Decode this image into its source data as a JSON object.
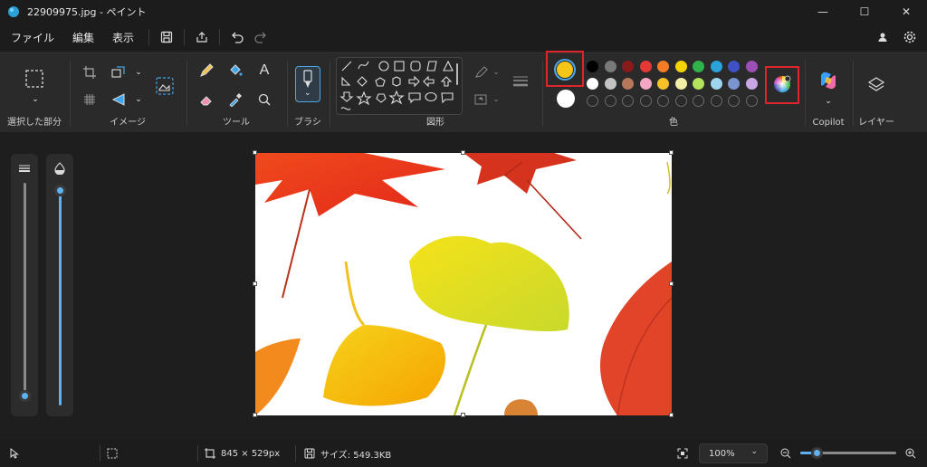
{
  "window": {
    "title": "22909975.jpg - ペイント",
    "controls": [
      "minimize-icon",
      "maximize-icon",
      "close-icon"
    ]
  },
  "menu": {
    "file": "ファイル",
    "edit": "編集",
    "view": "表示"
  },
  "ribbon": {
    "selection_label": "選択した部分",
    "image_label": "イメージ",
    "tools_label": "ツール",
    "brush_label": "ブラシ",
    "shapes_label": "図形",
    "colors_label": "色",
    "copilot_label": "Copilot",
    "layers_label": "レイヤー"
  },
  "colors": {
    "primary": "#f5c518",
    "secondary": "#ffffff",
    "palette_row1": [
      "#000000",
      "#7a7a7a",
      "#8b1a1a",
      "#e53935",
      "#f57c24",
      "#f5d400",
      "#2fb34a",
      "#29a3d9",
      "#3f51c4",
      "#9c4fb5"
    ],
    "palette_row2": [
      "#ffffff",
      "#c3c3c3",
      "#b5785a",
      "#f4a7c3",
      "#f7c227",
      "#f2f0a6",
      "#b5e25c",
      "#9fd6ee",
      "#7b95d1",
      "#c9a7e2"
    ]
  },
  "status": {
    "dimensions": "845 × 529px",
    "size": "サイズ: 549.3KB",
    "zoom": "100%"
  }
}
